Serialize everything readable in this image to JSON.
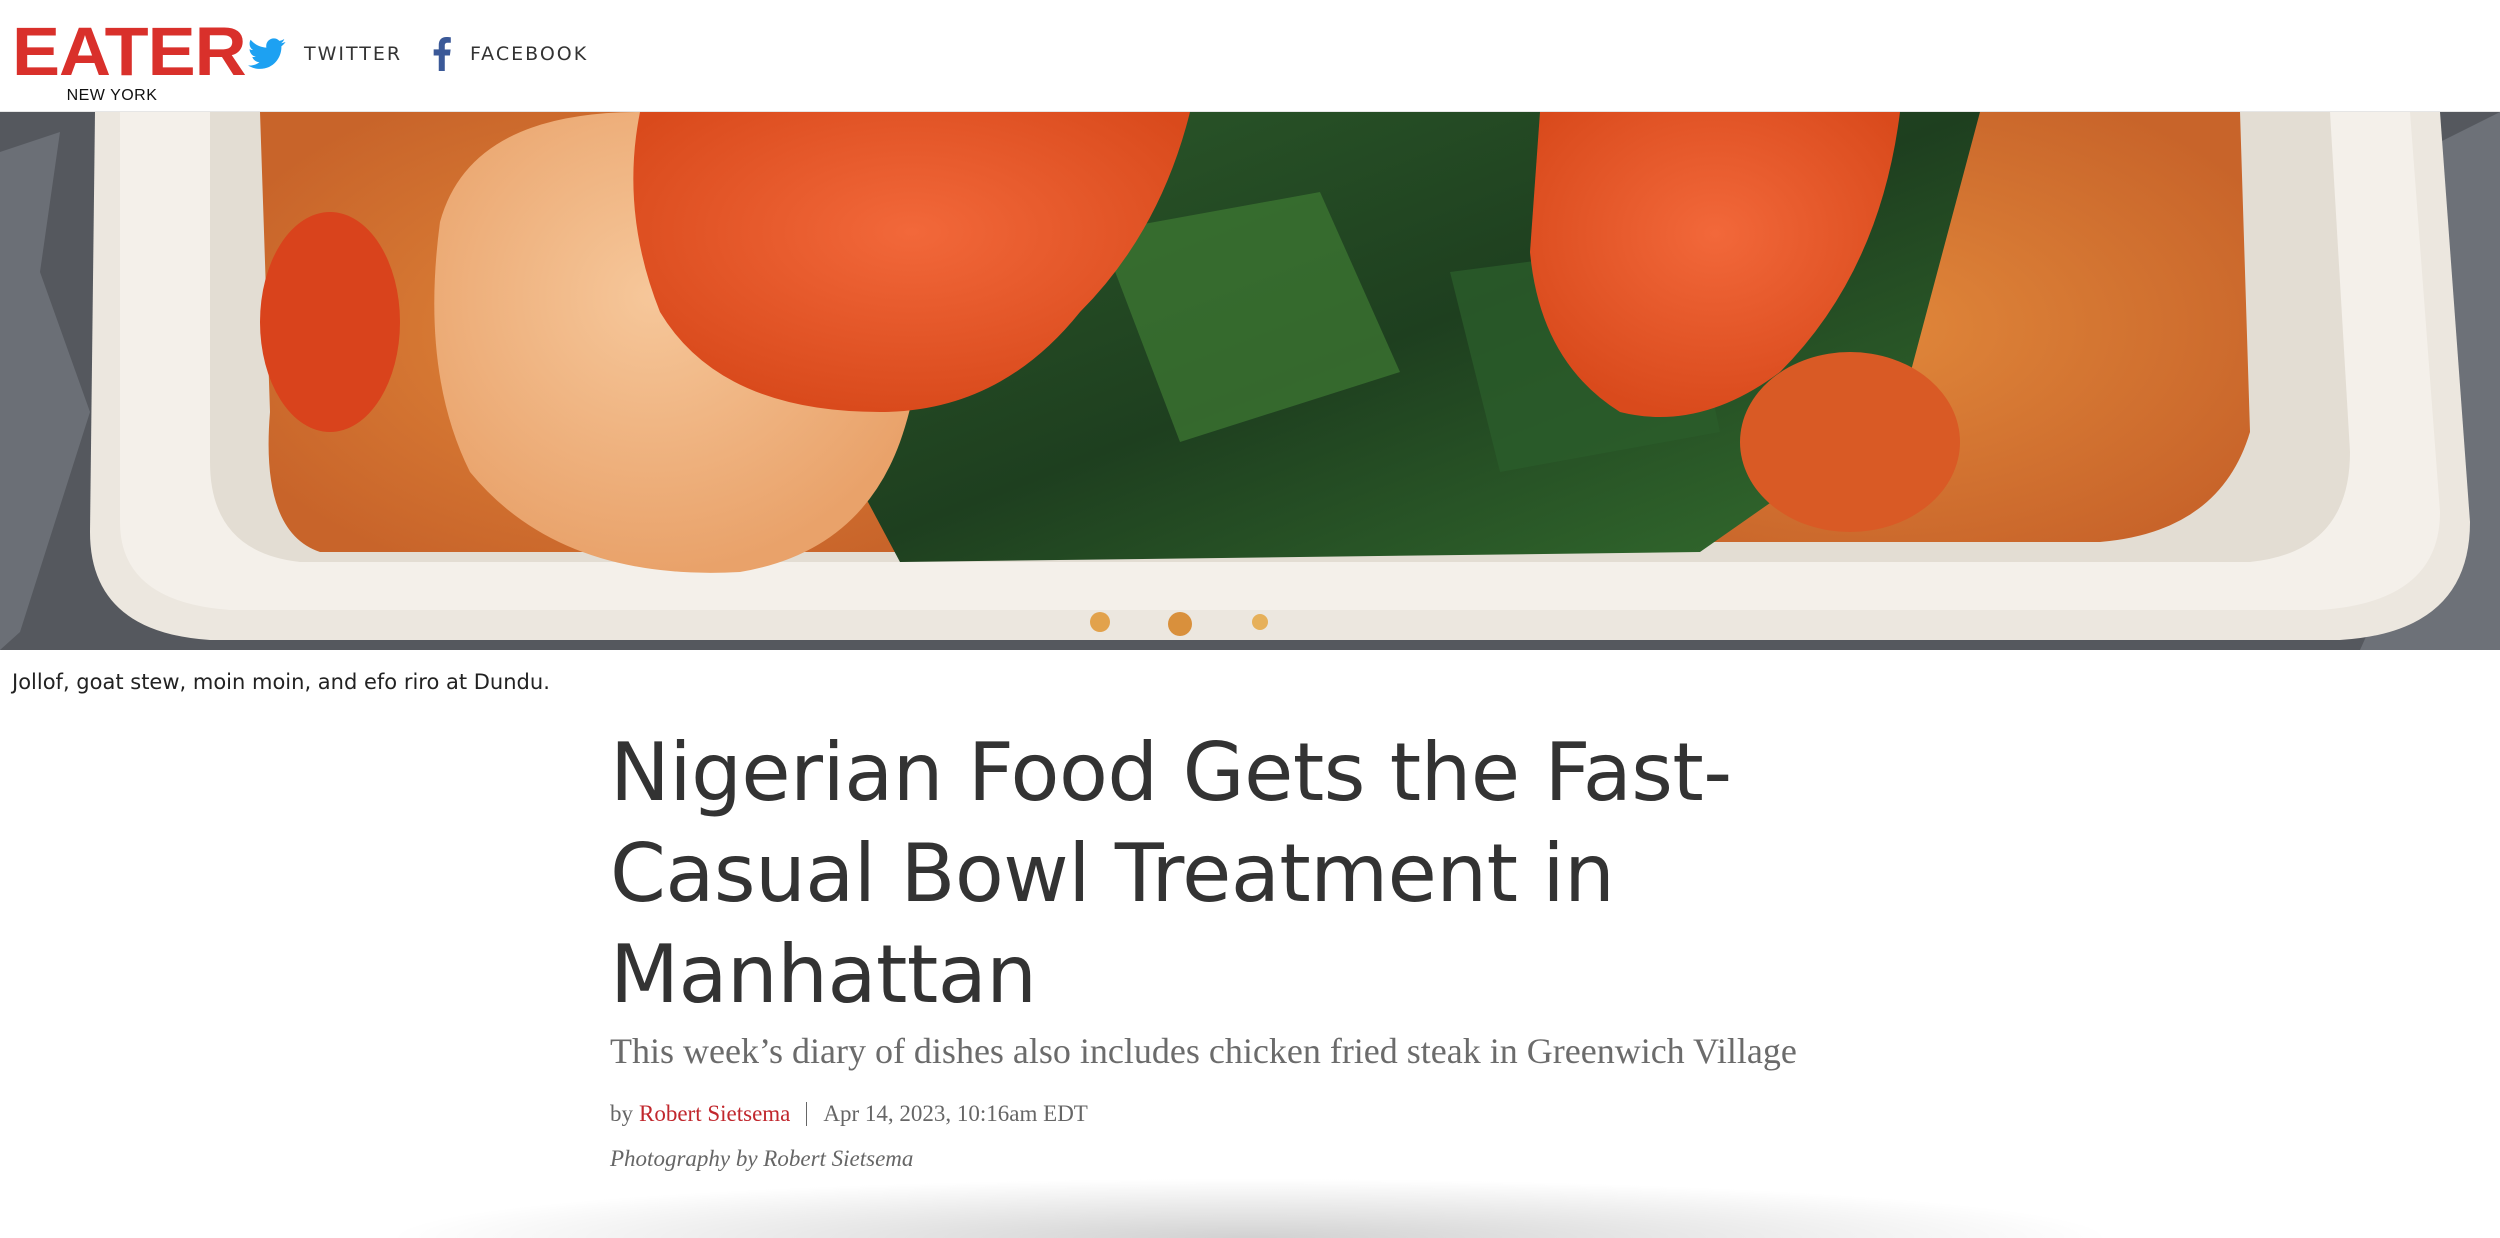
{
  "header": {
    "logo_text": "EATER",
    "logo_subtext": "NEW YORK",
    "social": [
      {
        "label": "TWITTER",
        "icon": "twitter-bird-icon",
        "color": "#1da1f2"
      },
      {
        "label": "FACEBOOK",
        "icon": "facebook-f-icon",
        "color": "#3b5998"
      }
    ],
    "brand_color": "#d9302b"
  },
  "hero": {
    "image_description": "Jollof, goat stew, moin moin, and efo riro in a bowl",
    "caption": "Jollof, goat stew, moin moin, and efo riro at Dundu."
  },
  "article": {
    "headline": "Nigerian Food Gets the Fast-Casual Bowl Treatment in Manhattan",
    "dek": "This week’s diary of dishes also includes chicken fried steak in Greenwich Village",
    "by_prefix": "by",
    "author": "Robert Sietsema",
    "date": "Apr 14, 2023, 10:16am EDT",
    "photo_credit": "Photography by Robert Sietsema",
    "author_color": "#c1272d"
  }
}
